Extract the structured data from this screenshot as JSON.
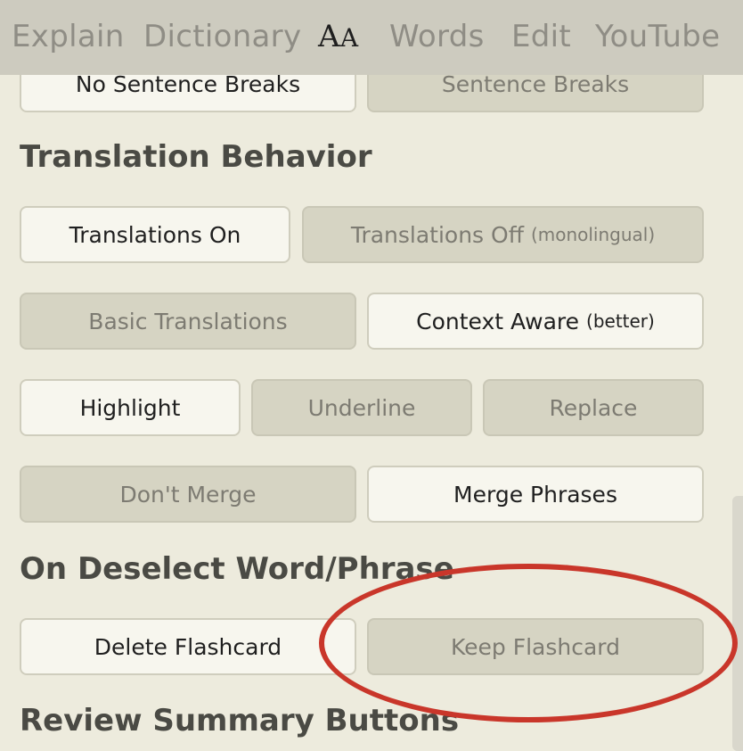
{
  "tabs": [
    {
      "label": "Explain"
    },
    {
      "label": "Dictionary"
    },
    {
      "label_big": "A",
      "label_small": "A"
    },
    {
      "label": "Words"
    },
    {
      "label": "Edit"
    },
    {
      "label": "YouTube"
    }
  ],
  "sentence": {
    "no_breaks": "No Sentence Breaks",
    "breaks": "Sentence Breaks"
  },
  "translation": {
    "title": "Translation Behavior",
    "on": "Translations On",
    "off": "Translations Off",
    "off_sub": "(monolingual)",
    "basic": "Basic Translations",
    "context": "Context Aware",
    "context_sub": "(better)",
    "highlight": "Highlight",
    "underline": "Underline",
    "replace": "Replace",
    "dont_merge": "Don't Merge",
    "merge": "Merge Phrases"
  },
  "deselect": {
    "title": "On Deselect Word/Phrase",
    "delete": "Delete Flashcard",
    "keep": "Keep Flashcard"
  },
  "review": {
    "title": "Review Summary Buttons"
  },
  "colors": {
    "annotation": "#c9362a",
    "selected_bg": "#f7f6ee",
    "unselected_bg": "#d6d4c3"
  }
}
